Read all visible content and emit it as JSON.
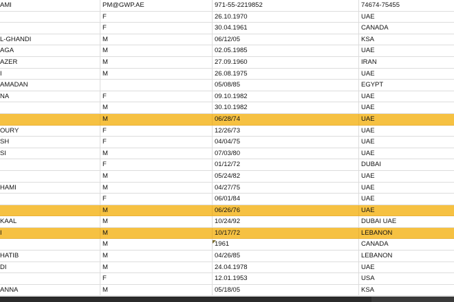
{
  "header": [
    "AMI",
    "PM@GWP.AE",
    "971-55-2219852",
    "74674-75455"
  ],
  "rows": [
    {
      "name": "",
      "gender": "F",
      "dob": "26.10.1970",
      "country": "UAE",
      "highlight": false
    },
    {
      "name": "",
      "gender": "F",
      "dob": "30.04.1961",
      "country": "CANADA",
      "highlight": false
    },
    {
      "name": "L-GHANDI",
      "gender": "M",
      "dob": "06/12/05",
      "country": "KSA",
      "highlight": false
    },
    {
      "name": "AGA",
      "gender": "M",
      "dob": "02.05.1985",
      "country": "UAE",
      "highlight": false
    },
    {
      "name": "AZER",
      "gender": "M",
      "dob": "27.09.1960",
      "country": "IRAN",
      "highlight": false
    },
    {
      "name": "I",
      "gender": "M",
      "dob": "26.08.1975",
      "country": "UAE",
      "highlight": false
    },
    {
      "name": "AMADAN",
      "gender": "",
      "dob": "05/08/85",
      "country": "EGYPT",
      "highlight": false
    },
    {
      "name": "NA",
      "gender": "F",
      "dob": "09.10.1982",
      "country": "UAE",
      "highlight": false
    },
    {
      "name": "",
      "gender": "M",
      "dob": "30.10.1982",
      "country": "UAE",
      "highlight": false
    },
    {
      "name": "",
      "gender": "M",
      "dob": "06/28/74",
      "country": "UAE",
      "highlight": true
    },
    {
      "name": "OURY",
      "gender": "F",
      "dob": "12/26/73",
      "country": "UAE",
      "highlight": false
    },
    {
      "name": "SH",
      "gender": "F",
      "dob": "04/04/75",
      "country": "UAE",
      "highlight": false
    },
    {
      "name": "SI",
      "gender": "M",
      "dob": "07/03/80",
      "country": "UAE",
      "highlight": false
    },
    {
      "name": "",
      "gender": "F",
      "dob": "01/12/72",
      "country": "DUBAI",
      "highlight": false
    },
    {
      "name": "",
      "gender": "M",
      "dob": "05/24/82",
      "country": "UAE",
      "highlight": false
    },
    {
      "name": "HAMI",
      "gender": "M",
      "dob": "04/27/75",
      "country": "UAE",
      "highlight": false
    },
    {
      "name": "",
      "gender": "F",
      "dob": "06/01/84",
      "country": "UAE",
      "highlight": false
    },
    {
      "name": "",
      "gender": "M",
      "dob": "06/26/76",
      "country": "UAE",
      "highlight": true
    },
    {
      "name": "KAAL",
      "gender": "M",
      "dob": "10/24/92",
      "country": "DUBAI UAE",
      "highlight": false
    },
    {
      "name": "I",
      "gender": "M",
      "dob": "10/17/72",
      "country": "LEBANON",
      "highlight": true
    },
    {
      "name": "",
      "gender": "M",
      "dob": "1961",
      "country": "CANADA",
      "highlight": false,
      "comment": true
    },
    {
      "name": "HATIB",
      "gender": "M",
      "dob": "04/26/85",
      "country": "LEBANON",
      "highlight": false
    },
    {
      "name": "DI",
      "gender": "M",
      "dob": "24.04.1978",
      "country": "UAE",
      "highlight": false
    },
    {
      "name": "",
      "gender": "F",
      "dob": "12.01.1953",
      "country": "USA",
      "highlight": false
    },
    {
      "name": "ANNA",
      "gender": "M",
      "dob": "05/18/05",
      "country": "KSA",
      "highlight": false
    }
  ]
}
